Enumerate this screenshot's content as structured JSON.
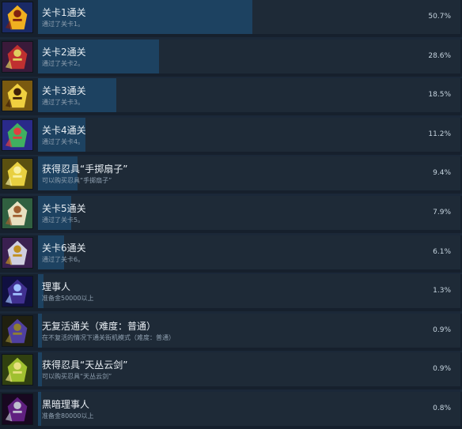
{
  "achievements": [
    {
      "title": "关卡1通关",
      "desc": "通过了关卡1。",
      "pct": "50.7%",
      "fill": 50.7,
      "icon": "boss-dragon-icon",
      "palette": [
        "#1a2a66",
        "#f0b020",
        "#802010"
      ]
    },
    {
      "title": "关卡2通关",
      "desc": "通过了关卡2。",
      "pct": "28.6%",
      "fill": 28.6,
      "icon": "boss-mech-icon",
      "palette": [
        "#3a1a3a",
        "#c03030",
        "#e0d060"
      ]
    },
    {
      "title": "关卡3通关",
      "desc": "通过了关卡3。",
      "pct": "18.5%",
      "fill": 18.5,
      "icon": "boss-golden-knight-icon",
      "palette": [
        "#7a5a10",
        "#f0d040",
        "#402008"
      ]
    },
    {
      "title": "关卡4通关",
      "desc": "通过了关卡4。",
      "pct": "11.2%",
      "fill": 11.2,
      "icon": "boss-ogre-icon",
      "palette": [
        "#2a2a8a",
        "#40b060",
        "#e04040"
      ]
    },
    {
      "title": "获得忍具“手掷扇子”",
      "desc": "可以购买忍具“手掷扇子”",
      "pct": "9.4%",
      "fill": 9.4,
      "icon": "folding-fan-icon",
      "palette": [
        "#5a5010",
        "#e8d040",
        "#f8f0a0"
      ]
    },
    {
      "title": "关卡5通关",
      "desc": "通过了关卡5。",
      "pct": "7.9%",
      "fill": 7.9,
      "icon": "boss-soldier-icon",
      "palette": [
        "#306040",
        "#e8e0c0",
        "#a06030"
      ]
    },
    {
      "title": "关卡6通关",
      "desc": "通过了关卡6。",
      "pct": "6.1%",
      "fill": 6.1,
      "icon": "boss-armored-icon",
      "palette": [
        "#3a2050",
        "#d0d0e0",
        "#c09020"
      ]
    },
    {
      "title": "理事人",
      "desc": "准备金50000以上",
      "pct": "1.3%",
      "fill": 1.3,
      "icon": "ninja-icon",
      "palette": [
        "#101040",
        "#403090",
        "#a0c0ff"
      ]
    },
    {
      "title": "无复活通关（难度：普通）",
      "desc": "在不复活的情况下通关街机模式（难度：普通）",
      "pct": "0.9%",
      "fill": 0.9,
      "icon": "kneeling-ninja-icon",
      "palette": [
        "#202010",
        "#5040a0",
        "#908030"
      ]
    },
    {
      "title": "获得忍具“天丛云剑”",
      "desc": "可以购买忍具“天丛云剑”",
      "pct": "0.9%",
      "fill": 0.9,
      "icon": "sword-icon",
      "palette": [
        "#304010",
        "#a0c030",
        "#e8e080"
      ]
    },
    {
      "title": "黒暗理事人",
      "desc": "准备金80000以上",
      "pct": "0.8%",
      "fill": 0.8,
      "icon": "dark-ninja-icon",
      "palette": [
        "#180820",
        "#602080",
        "#c0c0d0"
      ]
    }
  ]
}
